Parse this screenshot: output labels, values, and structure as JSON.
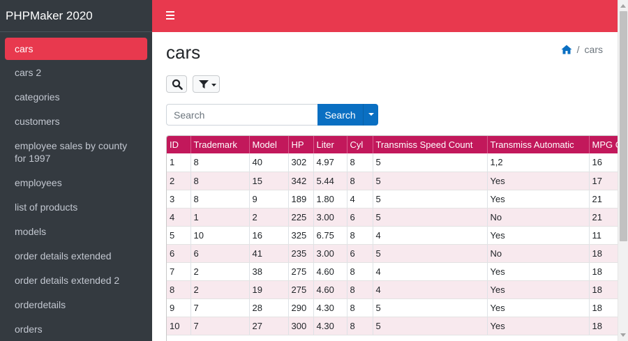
{
  "app": {
    "brand": "PHPMaker 2020"
  },
  "sidebar": {
    "items": [
      {
        "label": "cars",
        "active": true
      },
      {
        "label": "cars 2"
      },
      {
        "label": "categories"
      },
      {
        "label": "customers"
      },
      {
        "label": "employee sales by county for 1997"
      },
      {
        "label": "employees"
      },
      {
        "label": "list of products"
      },
      {
        "label": "models"
      },
      {
        "label": "order details extended"
      },
      {
        "label": "order details extended 2"
      },
      {
        "label": "orderdetails"
      },
      {
        "label": "orders"
      }
    ]
  },
  "header": {
    "menu_icon": "hamburger-icon"
  },
  "page": {
    "title": "cars",
    "breadcrumb": {
      "home_icon": "home-icon",
      "separator": "/",
      "current": "cars"
    }
  },
  "toolbar": {
    "search_icon": "search-icon",
    "filter_icon": "filter-icon"
  },
  "search": {
    "placeholder": "Search",
    "button_label": "Search"
  },
  "table": {
    "columns": [
      "ID",
      "Trademark",
      "Model",
      "HP",
      "Liter",
      "Cyl",
      "Transmiss Speed Count",
      "Transmiss Automatic",
      "MPG City"
    ],
    "rows": [
      [
        "1",
        "8",
        "40",
        "302",
        "4.97",
        "8",
        "5",
        "1,2",
        "16"
      ],
      [
        "2",
        "8",
        "15",
        "342",
        "5.44",
        "8",
        "5",
        "Yes",
        "17"
      ],
      [
        "3",
        "8",
        "9",
        "189",
        "1.80",
        "4",
        "5",
        "Yes",
        "21"
      ],
      [
        "4",
        "1",
        "2",
        "225",
        "3.00",
        "6",
        "5",
        "No",
        "21"
      ],
      [
        "5",
        "10",
        "16",
        "325",
        "6.75",
        "8",
        "4",
        "Yes",
        "11"
      ],
      [
        "6",
        "6",
        "41",
        "235",
        "3.00",
        "6",
        "5",
        "No",
        "18"
      ],
      [
        "7",
        "2",
        "38",
        "275",
        "4.60",
        "8",
        "4",
        "Yes",
        "18"
      ],
      [
        "8",
        "2",
        "19",
        "275",
        "4.60",
        "8",
        "4",
        "Yes",
        "18"
      ],
      [
        "9",
        "7",
        "28",
        "290",
        "4.30",
        "8",
        "5",
        "Yes",
        "18"
      ],
      [
        "10",
        "7",
        "27",
        "300",
        "4.30",
        "8",
        "5",
        "Yes",
        "18"
      ]
    ]
  },
  "colors": {
    "accent": "#e8394e",
    "sidebar_bg": "#343a40",
    "table_header": "#c2185b",
    "primary_button": "#0a6fc2",
    "row_stripe": "#f8e9ee"
  }
}
